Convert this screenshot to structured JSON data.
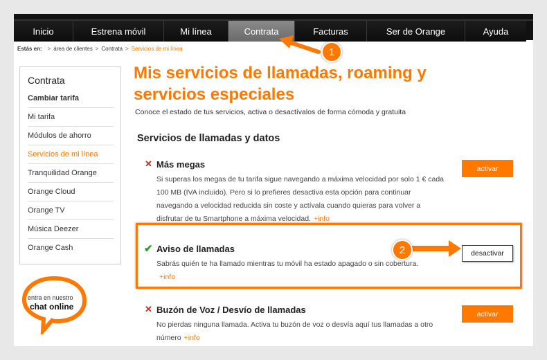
{
  "nav": {
    "items": [
      {
        "label": "Inicio"
      },
      {
        "label": "Estrena móvil"
      },
      {
        "label": "Mi línea"
      },
      {
        "label": "Contrata"
      },
      {
        "label": "Facturas"
      },
      {
        "label": "Ser de Orange"
      },
      {
        "label": "Ayuda"
      }
    ],
    "active_index": 3
  },
  "breadcrumb": {
    "label": "Estás en:",
    "items": [
      "área de clientes",
      "Contrata",
      "Servicios de mi línea"
    ]
  },
  "sidebar": {
    "title": "Contrata",
    "items": [
      {
        "label": "Cambiar tarifa"
      },
      {
        "label": "Mi tarifa"
      },
      {
        "label": "Módulos de ahorro"
      },
      {
        "label": "Servicios de mi línea"
      },
      {
        "label": "Tranquilidad Orange"
      },
      {
        "label": "Orange Cloud"
      },
      {
        "label": "Orange TV"
      },
      {
        "label": "Música Deezer"
      },
      {
        "label": "Orange Cash"
      }
    ]
  },
  "chat": {
    "line1": "entra en nuestro",
    "line2": "chat online"
  },
  "main": {
    "title": "Mis servicios de llamadas, roaming y servicios especiales",
    "subtitle": "Conoce el estado de tus servicios, activa o desactívalos de forma cómoda y gratuita",
    "section_title": "Servicios de llamadas y datos",
    "services": [
      {
        "title": "Más megas",
        "status": "inactive",
        "description": "Si superas los megas de tu tarifa sigue navegando a máxima velocidad por solo 1 € cada 100 MB (IVA incluido). Pero si lo prefieres desactiva esta opción para continuar navegando a velocidad reducida sin coste y actívala cuando quieras para volver a disfrutar de tu Smartphone a máxima velocidad.",
        "more_info": "+info",
        "button": "activar"
      },
      {
        "title": "Aviso de llamadas",
        "status": "active",
        "description": "Sabrás quién te ha llamado mientras tu móvil ha estado apagado o sin cobertura.",
        "more_info": "+info",
        "button": "desactivar"
      },
      {
        "title": "Buzón de Voz / Desvío de llamadas",
        "status": "inactive",
        "description": "No pierdas ninguna llamada. Activa tu buzón de voz o desvía aquí tus llamadas a otro número",
        "more_info": "+info",
        "button": "activar"
      }
    ]
  },
  "annotations": {
    "badge1": "1",
    "badge2": "2"
  },
  "colors": {
    "accent": "#ff7900",
    "nav_bg": "#111111",
    "check": "#2e9c2e",
    "cross": "#d62020"
  }
}
